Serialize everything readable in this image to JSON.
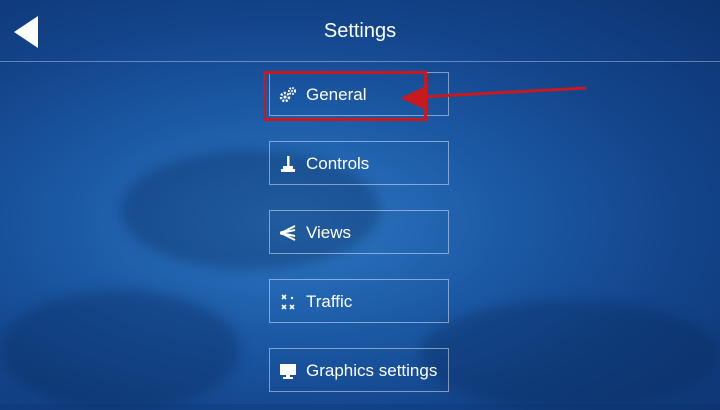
{
  "header": {
    "title": "Settings",
    "back_icon": "back-arrow-icon"
  },
  "menu": {
    "items": [
      {
        "label": "General",
        "icon": "gears-icon"
      },
      {
        "label": "Controls",
        "icon": "joystick-icon"
      },
      {
        "label": "Views",
        "icon": "views-icon"
      },
      {
        "label": "Traffic",
        "icon": "traffic-icon"
      },
      {
        "label": "Graphics settings",
        "icon": "monitor-icon"
      }
    ]
  },
  "annotation": {
    "highlight_color": "#c8191e"
  }
}
